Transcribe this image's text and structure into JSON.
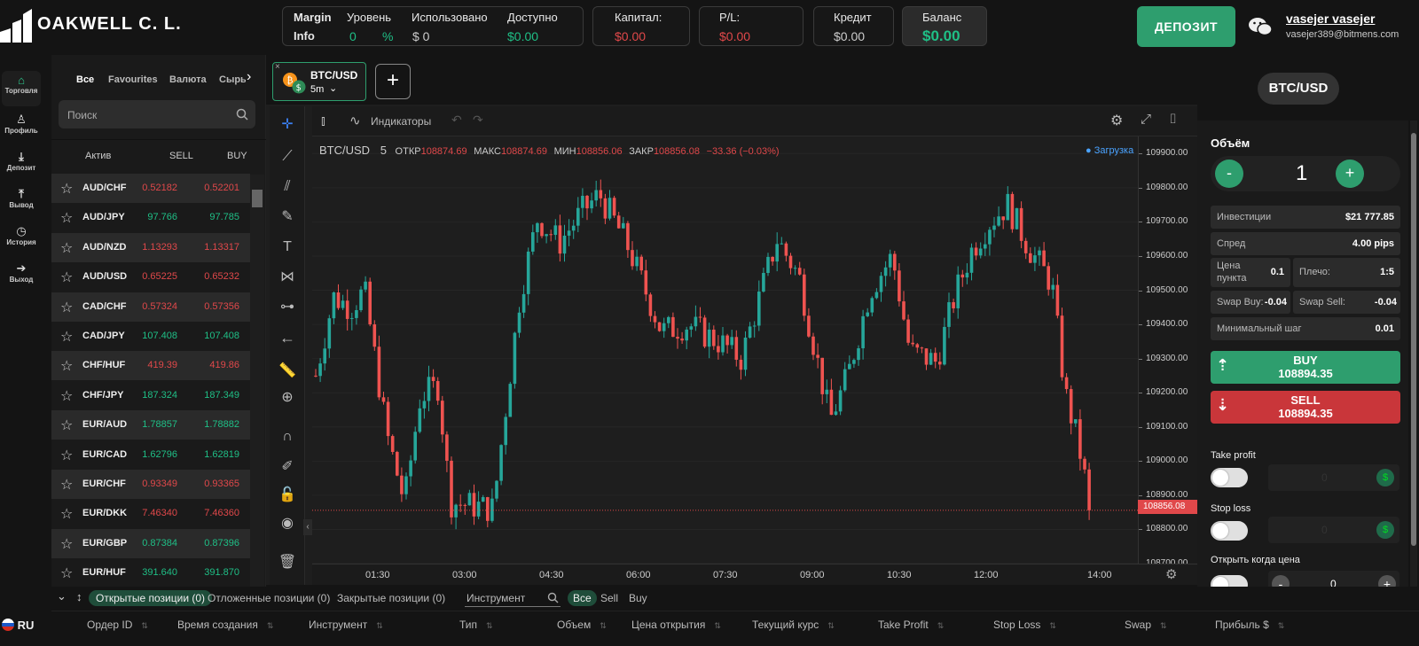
{
  "brand": {
    "name": "OAKWELL C. L."
  },
  "account": {
    "margin_info_label_1": "Margin",
    "margin_info_label_2": "Info",
    "level_label": "Уровень",
    "level_value": "0",
    "level_unit": "%",
    "used_label": "Использовано",
    "used_value": "$ 0",
    "available_label": "Доступно",
    "available_value": "$0.00",
    "capital_label": "Капитал:",
    "capital_value": "$0.00",
    "pl_label": "P/L:",
    "pl_value": "$0.00",
    "credit_label": "Кредит",
    "credit_value": "$0.00",
    "balance_label": "Баланс",
    "balance_value": "$0.00",
    "deposit_button": "ДЕПОЗИТ",
    "user_name": "vasejer vasejer",
    "user_email": "vasejer389@bitmens.com"
  },
  "nav": [
    {
      "label": "Торговля",
      "icon": "home-icon"
    },
    {
      "label": "Профиль",
      "icon": "user-icon"
    },
    {
      "label": "Депозит",
      "icon": "download-icon"
    },
    {
      "label": "Вывод",
      "icon": "upload-icon"
    },
    {
      "label": "История",
      "icon": "clock-icon"
    },
    {
      "label": "Выход",
      "icon": "logout-icon"
    }
  ],
  "language": "RU",
  "assets": {
    "tabs": [
      "Все",
      "Favourites",
      "Валюта",
      "Сырье"
    ],
    "search_placeholder": "Поиск",
    "headers": {
      "asset": "Актив",
      "sell": "SELL",
      "buy": "BUY"
    },
    "rows": [
      {
        "name": "AUD/CHF",
        "sell": "0.52182",
        "buy": "0.52201",
        "color": "#e0484a"
      },
      {
        "name": "AUD/JPY",
        "sell": "97.766",
        "buy": "97.785",
        "color": "#1fbf86"
      },
      {
        "name": "AUD/NZD",
        "sell": "1.13293",
        "buy": "1.13317",
        "color": "#e0484a"
      },
      {
        "name": "AUD/USD",
        "sell": "0.65225",
        "buy": "0.65232",
        "color": "#e0484a"
      },
      {
        "name": "CAD/CHF",
        "sell": "0.57324",
        "buy": "0.57356",
        "color": "#e0484a"
      },
      {
        "name": "CAD/JPY",
        "sell": "107.408",
        "buy": "107.408",
        "color": "#1fbf86"
      },
      {
        "name": "CHF/HUF",
        "sell": "419.39",
        "buy": "419.86",
        "color": "#e0484a"
      },
      {
        "name": "CHF/JPY",
        "sell": "187.324",
        "buy": "187.349",
        "color": "#1fbf86"
      },
      {
        "name": "EUR/AUD",
        "sell": "1.78857",
        "buy": "1.78882",
        "color": "#1fbf86"
      },
      {
        "name": "EUR/CAD",
        "sell": "1.62796",
        "buy": "1.62819",
        "color": "#1fbf86"
      },
      {
        "name": "EUR/CHF",
        "sell": "0.93349",
        "buy": "0.93365",
        "color": "#e0484a"
      },
      {
        "name": "EUR/DKK",
        "sell": "7.46340",
        "buy": "7.46360",
        "color": "#e0484a"
      },
      {
        "name": "EUR/GBP",
        "sell": "0.87384",
        "buy": "0.87396",
        "color": "#1fbf86"
      },
      {
        "name": "EUR/HUF",
        "sell": "391.640",
        "buy": "391.870",
        "color": "#1fbf86"
      }
    ]
  },
  "chart_tab": {
    "symbol": "BTC/USD",
    "interval": "5m"
  },
  "chart": {
    "indicators_label": "Индикаторы",
    "loading_label": "● Загрузка",
    "legend_symbol": "BTC/USD",
    "legend_interval": "5",
    "open_label": "ОТКР",
    "open_value": "108874.69",
    "high_label": "МАКС",
    "high_value": "108874.69",
    "low_label": "МИН",
    "low_value": "108856.06",
    "close_label": "ЗАКР",
    "close_value": "108856.08",
    "change": "−33.36 (−0.03%)",
    "last_price_tag": "108856.08",
    "last_price": 108856.08,
    "y_range": [
      108700,
      109950
    ],
    "price_ticks": [
      "109900.00",
      "109800.00",
      "109700.00",
      "109600.00",
      "109500.00",
      "109400.00",
      "109300.00",
      "109200.00",
      "109100.00",
      "109000.00",
      "108900.00",
      "108800.00",
      "108700.00"
    ],
    "time_ticks": [
      "01:30",
      "03:00",
      "04:30",
      "06:00",
      "07:30",
      "09:00",
      "10:30",
      "12:00",
      "14:00"
    ],
    "up_color": "#26a69a",
    "down_color": "#ef5350"
  },
  "trade": {
    "symbol": "BTC/USD",
    "volume_label": "Объём",
    "volume_value": "1",
    "minus": "-",
    "plus": "+",
    "invest_label": "Инвестиции",
    "invest_value": "$21 777.85",
    "spread_label": "Спред",
    "spread_value": "4.00 pips",
    "pip_label_1": "Цена",
    "pip_label_2": "пункта",
    "pip_value": "0.1",
    "leverage_label": "Плечо:",
    "leverage_value": "1:5",
    "swap_buy_label": "Swap Buy:",
    "swap_buy_value": "-0.04",
    "swap_sell_label": "Swap Sell:",
    "swap_sell_value": "-0.04",
    "min_step_label": "Минимальный шаг",
    "min_step_value": "0.01",
    "buy_label": "BUY",
    "buy_price": "108894.35",
    "sell_label": "SELL",
    "sell_price": "108894.35",
    "take_profit_label": "Take profit",
    "take_profit_value": "0",
    "stop_loss_label": "Stop loss",
    "stop_loss_value": "0",
    "open_when_label": "Открыть когда цена",
    "open_when_value": "0",
    "dollar_sign": "$",
    "buy_color": "#2e9e6e",
    "sell_color": "#c9363a"
  },
  "positions": {
    "tabs": [
      "Открытые позиции (0)",
      "Отложенные позиции (0)",
      "Закрытые позиции (0)"
    ],
    "instrument_placeholder": "Инструмент",
    "filters": [
      "Все",
      "Sell",
      "Buy"
    ],
    "columns": [
      "Ордер ID",
      "Время создания",
      "Инструмент",
      "Тип",
      "Объем",
      "Цена открытия",
      "Текущий курс",
      "Take Profit",
      "Stop Loss",
      "Swap",
      "Прибыль $"
    ]
  }
}
